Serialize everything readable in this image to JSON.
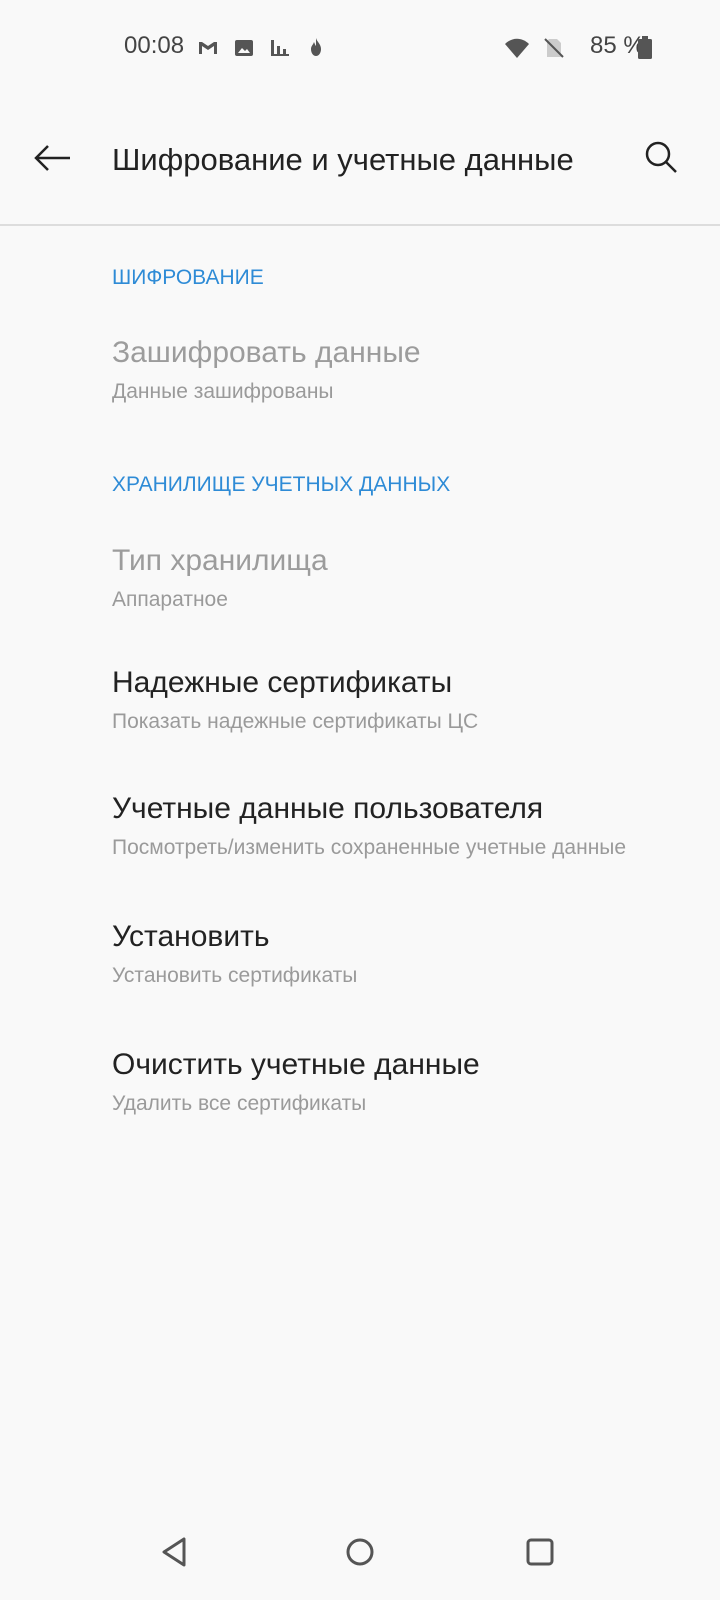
{
  "status_bar": {
    "time": "00:08",
    "battery_percent": "85 %",
    "icons": [
      "gmail-icon",
      "image-icon",
      "stats-icon",
      "fire-icon",
      "wifi-icon",
      "no-sim-icon",
      "battery-icon"
    ]
  },
  "app_bar": {
    "title": "Шифрование и учетные данные",
    "back_icon": "arrow-back-icon",
    "search_icon": "search-icon"
  },
  "sections": [
    {
      "header": "ШИФРОВАНИЕ",
      "items": [
        {
          "title": "Зашифровать данные",
          "summary": "Данные зашифрованы",
          "enabled": false
        }
      ]
    },
    {
      "header": "ХРАНИЛИЩЕ УЧЕТНЫХ ДАННЫХ",
      "items": [
        {
          "title": "Тип хранилища",
          "summary": "Аппаратное",
          "enabled": false
        },
        {
          "title": "Надежные сертификаты",
          "summary": "Показать надежные сертификаты ЦС",
          "enabled": true
        },
        {
          "title": "Учетные данные пользователя",
          "summary": "Посмотреть/изменить сохраненные учетные данные",
          "enabled": true
        },
        {
          "title": "Установить",
          "summary": "Установить сертификаты",
          "enabled": true
        },
        {
          "title": "Очистить учетные данные",
          "summary": "Удалить все сертификаты",
          "enabled": true
        }
      ]
    }
  ],
  "nav_bar": {
    "icons": [
      "nav-back-icon",
      "nav-home-icon",
      "nav-recents-icon"
    ]
  },
  "colors": {
    "background": "#f9f9f9",
    "accent": "#2e8bd6",
    "primary_text": "#222222",
    "secondary_text": "#9a9a9a"
  }
}
